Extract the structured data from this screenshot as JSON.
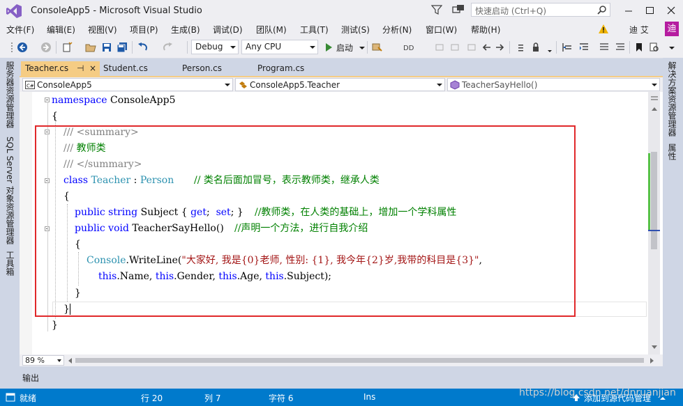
{
  "window": {
    "title": "ConsoleApp5 - Microsoft Visual Studio",
    "quick_launch_placeholder": "快速启动 (Ctrl+Q)"
  },
  "menu": {
    "items": [
      "文件(F)",
      "编辑(E)",
      "视图(V)",
      "项目(P)",
      "生成(B)",
      "调试(D)",
      "团队(M)",
      "工具(T)",
      "测试(S)",
      "分析(N)",
      "窗口(W)",
      "帮助(H)"
    ],
    "user": "迪 艾",
    "user_badge": "迪"
  },
  "toolbar": {
    "config": "Debug",
    "platform": "Any CPU",
    "start": "启动"
  },
  "left_panels": [
    "服务器资源管理器",
    "SQL Server 对象资源管理器",
    "工具箱"
  ],
  "right_panels": [
    "解决方案资源管理器",
    "属性"
  ],
  "tabs": [
    {
      "label": "Teacher.cs",
      "pin": "⊣",
      "close": "×"
    },
    {
      "label": "Student.cs"
    },
    {
      "label": "Person.cs"
    },
    {
      "label": "Program.cs"
    }
  ],
  "navbar": {
    "project": "ConsoleApp5",
    "type": "ConsoleApp5.Teacher",
    "member": "TeacherSayHello()"
  },
  "code": {
    "l1_kw": "namespace",
    "l1_name": " ConsoleApp5",
    "l2": "{",
    "l3": "/// <summary>",
    "l4_a": "/// ",
    "l4_b": "教师类",
    "l5": "/// </summary>",
    "l6_kw": "class",
    "l6_type": " Teacher",
    "l6_sep": " : ",
    "l6_base": "Person",
    "l6_cm": "// 类名后面加冒号，表示教师类，继承人类",
    "l7": "{",
    "l8_kw": "public string",
    "l8_name": " Subject { ",
    "l8_get": "get",
    "l8_mid": ";  ",
    "l8_set": "set",
    "l8_end": "; }",
    "l8_cm": "//教师类，在人类的基础上，增加一个学科属性",
    "l9_kw": "public void",
    "l9_name": " TeacherSayHello()",
    "l9_cm": "//声明一个方法，进行自我介绍",
    "l10": "{",
    "l11_type": "Console",
    "l11_call": ".WriteLine(",
    "l11_str": "\"大家好, 我是{0}老师, 性别: {1}, 我今年{2}岁,我带的科目是{3}\"",
    "l11_end": ",",
    "l12_this1": "this",
    "l12_a": ".Name, ",
    "l12_this2": "this",
    "l12_b": ".Gender, ",
    "l12_this3": "this",
    "l12_c": ".Age, ",
    "l12_this4": "this",
    "l12_d": ".Subject);",
    "l13": "}",
    "l14": "}",
    "l15": "}"
  },
  "zoom": "89 %",
  "output_tab": "输出",
  "status": {
    "ready": "就绪",
    "line": "行 20",
    "col": "列 7",
    "char": "字符 6",
    "ins": "Ins",
    "source_control": "添加到源代码管理"
  },
  "watermark": "https://blog.csdn.net/dnruanjian",
  "colors": {
    "status_bar": "#007acc",
    "active_tab": "#f5cc84",
    "highlight_box": "#e0282a",
    "keyword": "#0000ff",
    "type": "#2b91af",
    "comment": "#008000",
    "string": "#a31515"
  }
}
